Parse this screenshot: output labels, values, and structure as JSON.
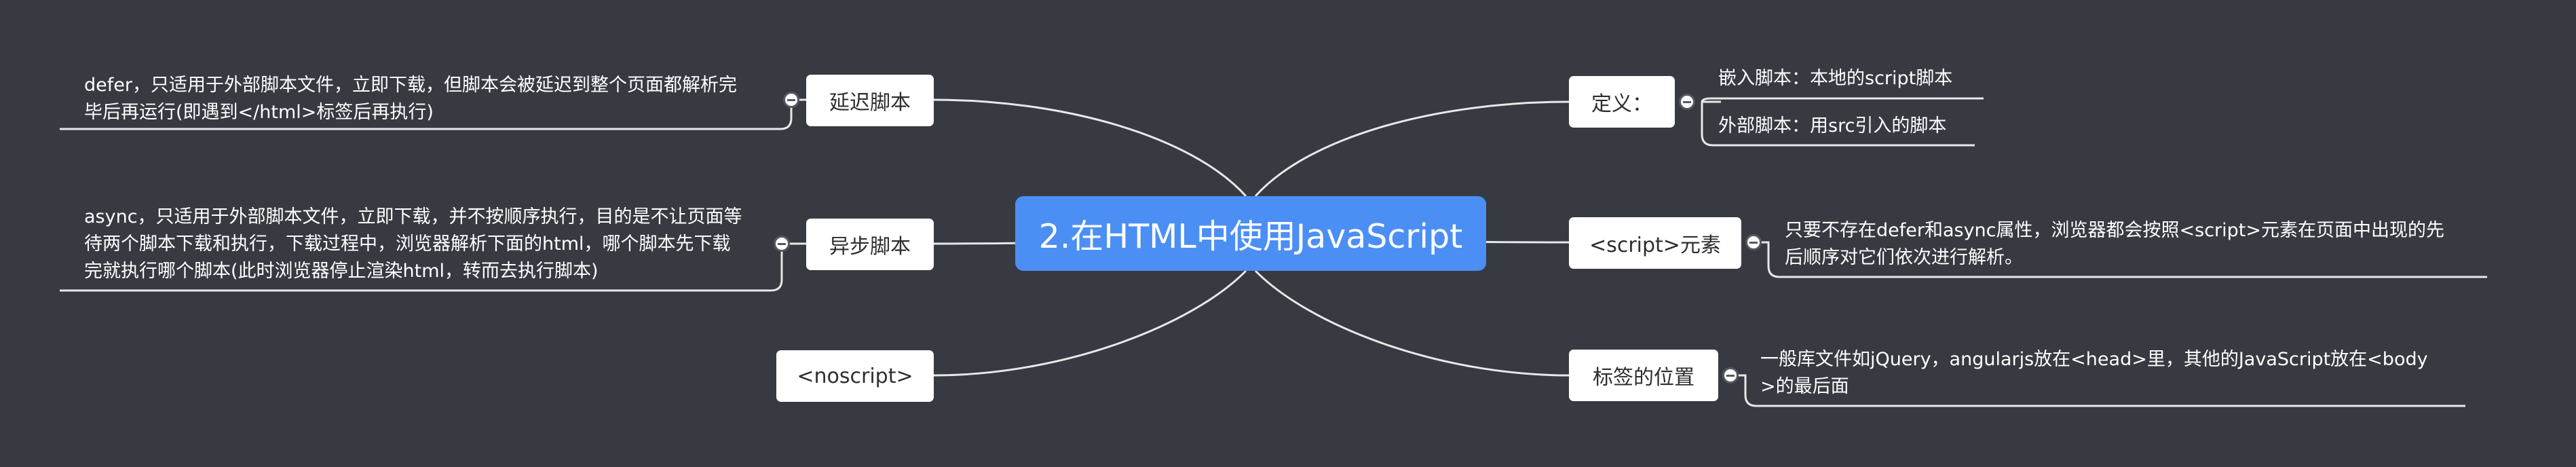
{
  "central_topic": "2.在HTML中使用JavaScript",
  "right": {
    "definition": {
      "label": "定义：",
      "items": [
        "嵌入脚本：本地的script脚本",
        "外部脚本：用src引入的脚本"
      ]
    },
    "script_element": {
      "label": "<script>元素",
      "note": "只要不存在defer和async属性，浏览器都会按照<script>元素在页面中出现的先\n后顺序对它们依次进行解析。"
    },
    "tag_position": {
      "label": "标签的位置",
      "note": "一般库文件如jQuery，angularjs放在<head>里，其他的JavaScript放在<body\n>的最后面"
    }
  },
  "left": {
    "defer": {
      "label": "延迟脚本",
      "note": "defer，只适用于外部脚本文件，立即下载，但脚本会被延迟到整个页面都解析完\n毕后再运行(即遇到</html>标签后再执行)"
    },
    "async": {
      "label": "异步脚本",
      "note": "async，只适用于外部脚本文件，立即下载，并不按顺序执行，目的是不让页面等\n待两个脚本下载和执行，下载过程中，浏览器解析下面的html，哪个脚本先下载\n完就执行哪个脚本(此时浏览器停止渲染html，转而去执行脚本)"
    },
    "noscript": {
      "label": "<noscript>"
    }
  },
  "colors": {
    "background": "#373a40",
    "central_fill": "#4b8ff5",
    "topic_fill": "#ffffff",
    "connector": "#e8e8e8"
  }
}
